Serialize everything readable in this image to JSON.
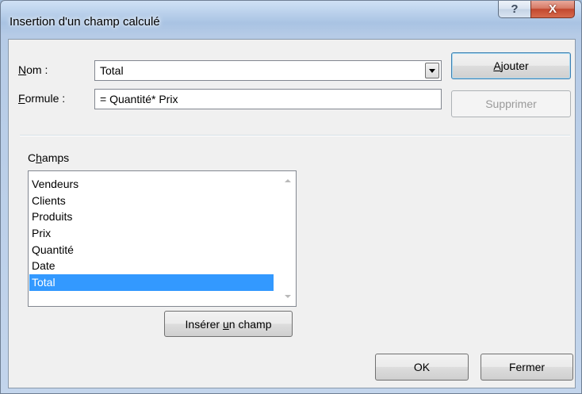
{
  "window": {
    "title": "Insertion d'un champ calculé",
    "help_label": "?",
    "close_label": "X"
  },
  "form": {
    "name_label_ul": "N",
    "name_label_rest": "om :",
    "name_value": "Total",
    "formula_label_ul": "F",
    "formula_label_rest": "ormule :",
    "formula_value": "= Quantité* Prix"
  },
  "buttons": {
    "add_ul": "A",
    "add_rest": "jouter",
    "delete_label": "Supprimer",
    "insert_pre": "Insérer ",
    "insert_ul": "u",
    "insert_post": "n champ",
    "ok_label": "OK",
    "close_label": "Fermer"
  },
  "fields": {
    "label_pre": "C",
    "label_ul": "h",
    "label_post": "amps",
    "items": [
      "Vendeurs",
      "Clients",
      "Produits",
      "Prix",
      "Quantité",
      "Date",
      "Total"
    ],
    "selected_index": 6
  },
  "colors": {
    "selection": "#3399ff",
    "close_button": "#c2482f"
  },
  "icons": {
    "help": "question-mark-icon",
    "close": "close-icon",
    "dropdown": "chevron-down-icon"
  }
}
